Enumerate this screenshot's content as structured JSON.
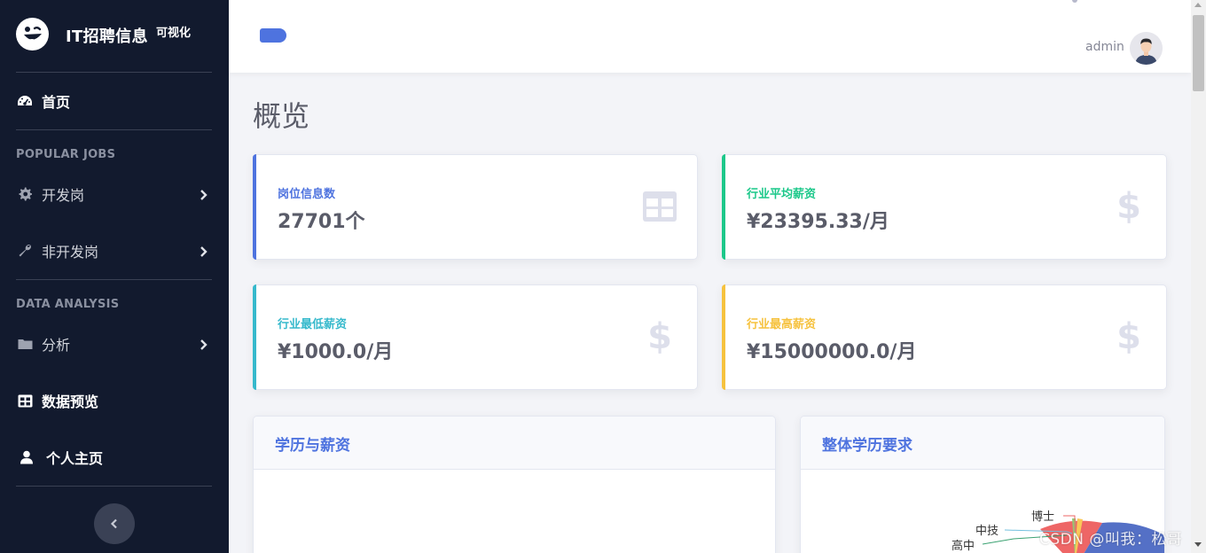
{
  "brand": {
    "title": "IT招聘信息",
    "sup": "可视化"
  },
  "sidebar": {
    "home": "首页",
    "section_popular": "POPULAR JOBS",
    "dev_jobs": "开发岗",
    "non_dev_jobs": "非开发岗",
    "section_analysis": "DATA ANALYSIS",
    "analysis": "分析",
    "data_preview": "数据预览",
    "profile": "个人主页"
  },
  "topbar": {
    "user": "admin"
  },
  "page": {
    "title": "概览"
  },
  "cards": [
    {
      "label": "岗位信息数",
      "value": "27701个",
      "color": "#4e73df",
      "icon": "table-icon"
    },
    {
      "label": "行业平均薪资",
      "value": "¥23395.33/月",
      "color": "#1cc88a",
      "icon": "dollar-icon"
    },
    {
      "label": "行业最低薪资",
      "value": "¥1000.0/月",
      "color": "#36b9cc",
      "icon": "dollar-icon"
    },
    {
      "label": "行业最高薪资",
      "value": "¥15000000.0/月",
      "color": "#f6c23e",
      "icon": "dollar-icon"
    }
  ],
  "panels": {
    "edu_salary": "学历与薪资",
    "edu_overall": "整体学历要求"
  },
  "chart_data": {
    "type": "pie",
    "title": "整体学历要求",
    "categories": [
      "博士",
      "中技",
      "高中"
    ]
  },
  "watermark": "CSDN @叫我：松哥"
}
